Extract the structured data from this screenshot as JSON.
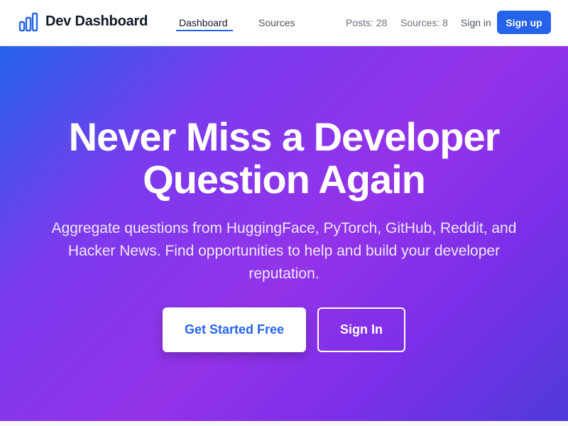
{
  "header": {
    "brand": "Dev Dashboard",
    "logo_icon": "bar-chart-icon",
    "nav": [
      {
        "label": "Dashboard",
        "active": true
      },
      {
        "label": "Sources",
        "active": false
      }
    ],
    "stats": {
      "posts": "Posts: 28",
      "sources": "Sources: 8"
    },
    "signin_label": "Sign in",
    "signup_label": "Sign up"
  },
  "hero": {
    "title_lines": [
      "Never Miss a Developer",
      "Question Again"
    ],
    "subtitle_lines": [
      "Aggregate questions from HuggingFace, PyTorch, GitHub, Reddit, and",
      "Hacker News. Find opportunities to help and build your developer",
      "reputation."
    ],
    "primary_cta": "Get Started Free",
    "secondary_cta": "Sign In"
  },
  "colors": {
    "accent": "#2563eb",
    "gradient_start": "#2563eb",
    "gradient_mid": "#9333ea",
    "gradient_end": "#4f3ad9"
  }
}
